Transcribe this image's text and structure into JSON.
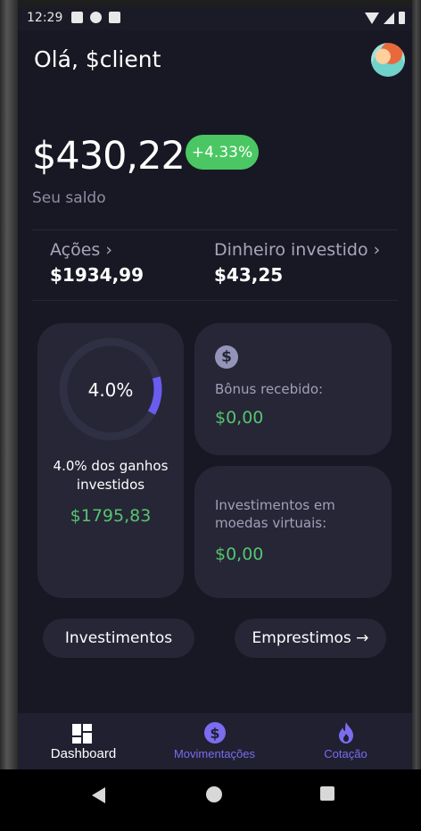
{
  "status_bar": {
    "time": "12:29"
  },
  "header": {
    "greeting": "Olá, $client"
  },
  "balance": {
    "amount": "$430,22",
    "change_badge": "+4.33%",
    "label": "Seu saldo"
  },
  "stats": [
    {
      "label": "Ações",
      "value": "$1934,99"
    },
    {
      "label": "Dinheiro investido",
      "value": "$43,25"
    }
  ],
  "gains_card": {
    "percent_text": "4.0%",
    "progress_fraction": 0.04,
    "description": "4.0% dos ganhos investidos",
    "value": "$1795,83"
  },
  "bonus_card": {
    "label": "Bônus recebido:",
    "value": "$0,00"
  },
  "virtual_card": {
    "label": "Investimentos em moedas virtuais:",
    "value": "$0,00"
  },
  "actions": {
    "investments": "Investimentos",
    "loans": "Emprestimos →"
  },
  "bottom_nav": [
    {
      "label": "Dashboard",
      "color": "#ffffff"
    },
    {
      "label": "Movimentações",
      "color": "#7b6cf0"
    },
    {
      "label": "Cotação",
      "color": "#7b6cf0"
    }
  ],
  "colors": {
    "accent": "#7b6cf0",
    "positive": "#56c46f",
    "badge": "#4ac763",
    "background": "#181824",
    "card": "#262636"
  }
}
